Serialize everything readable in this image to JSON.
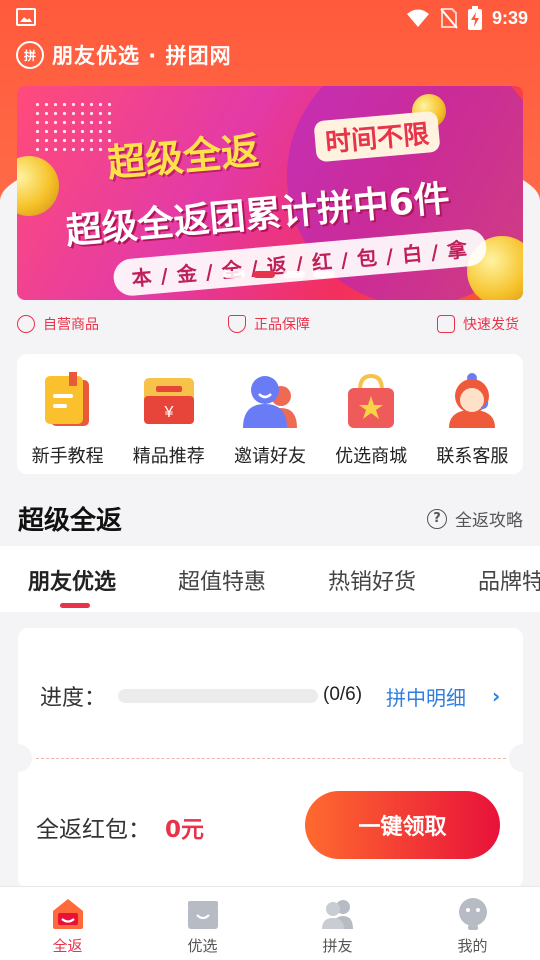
{
  "status_bar": {
    "time": "9:39"
  },
  "brand": {
    "logo_text": "拼",
    "name": "朋友优选 · 拼团网"
  },
  "banner": {
    "headline": "超级全返",
    "tag": "时间不限",
    "subline": "超级全返团累计拼中6件",
    "strip": "本 / 金 / 全 / 返 / 红 / 包 / 白 / 拿",
    "pages": 4,
    "active_page": 2
  },
  "guarantees": [
    {
      "label": "自营商品",
      "icon": "person-icon"
    },
    {
      "label": "正品保障",
      "icon": "shield-check-icon"
    },
    {
      "label": "快速发货",
      "icon": "delivery-icon"
    }
  ],
  "features": [
    {
      "label": "新手教程",
      "icon": "book-icon"
    },
    {
      "label": "精品推荐",
      "icon": "red-envelope-icon"
    },
    {
      "label": "邀请好友",
      "icon": "friends-icon"
    },
    {
      "label": "优选商城",
      "icon": "shopping-bag-icon"
    },
    {
      "label": "联系客服",
      "icon": "customer-service-icon"
    }
  ],
  "section": {
    "title": "超级全返",
    "link": "全返攻略",
    "link_icon": "?"
  },
  "tabs": [
    {
      "label": "朋友优选",
      "active": true
    },
    {
      "label": "超值特惠",
      "active": false
    },
    {
      "label": "热销好货",
      "active": false
    },
    {
      "label": "品牌特",
      "active": false
    }
  ],
  "progress_card": {
    "label": "进度：",
    "count": "(0/6)",
    "progress_fraction": 0,
    "detail_link": "拼中明细",
    "detail_arrow": "›",
    "redpacket_label": "全返红包：",
    "redpacket_value": "0元",
    "claim_button": "一键领取"
  },
  "bottom_nav": [
    {
      "label": "全返",
      "icon": "home-gift-icon",
      "active": true
    },
    {
      "label": "优选",
      "icon": "basket-icon",
      "active": false
    },
    {
      "label": "拼友",
      "icon": "group-icon",
      "active": false
    },
    {
      "label": "我的",
      "icon": "profile-icon",
      "active": false
    }
  ],
  "colors": {
    "brand": "#ff5a3c",
    "accent": "#e8334a",
    "link": "#2f7fe0"
  }
}
